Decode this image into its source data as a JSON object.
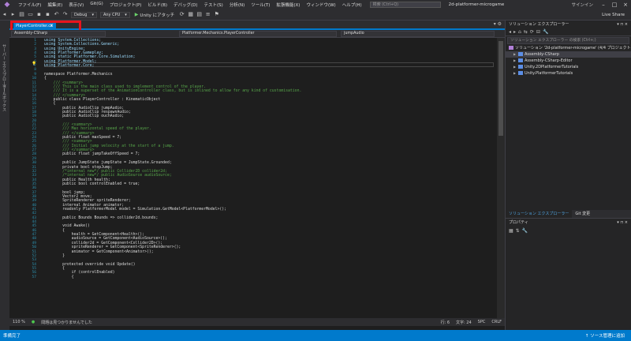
{
  "menu": {
    "items": [
      "ファイル(F)",
      "編集(E)",
      "表示(V)",
      "Git(G)",
      "プロジェクト(P)",
      "ビルド(B)",
      "デバッグ(D)",
      "テスト(S)",
      "分析(N)",
      "ツール(T)",
      "拡張機能(X)",
      "ウィンドウ(W)",
      "ヘルプ(H)"
    ],
    "search_placeholder": "検索 (Ctrl+Q)",
    "solution_name": "2d-platformer-microgame",
    "signin": "サインイン"
  },
  "toolbar": {
    "config": "Debug",
    "platform": "Any CPU",
    "run_label": "Unity にアタッチ",
    "live_share": "Live Share"
  },
  "left_strip": {
    "item1": "サーバー エクスプローラー",
    "item2": "ツールボックス"
  },
  "tabs": {
    "active_file": "PlayerController.cs"
  },
  "navbar": {
    "project": "Assembly-CSharp",
    "class": "Platformer.Mechanics.PlayerController",
    "member": "jumpAudio"
  },
  "editor": {
    "code_lines": [
      {
        "n": "1",
        "t": "using System.Collections;"
      },
      {
        "n": "2",
        "t": "using System.Collections.Generic;"
      },
      {
        "n": "3",
        "t": "using UnityEngine;"
      },
      {
        "n": "4",
        "t": "using Platformer.Gameplay;"
      },
      {
        "n": "5",
        "t": "using static Platformer.Core.Simulation;"
      },
      {
        "n": "6",
        "t": "using Platformer.Model;"
      },
      {
        "n": "7",
        "t": "using Platformer.Core;"
      },
      {
        "n": "8",
        "t": ""
      },
      {
        "n": "9",
        "t": "namespace Platformer.Mechanics"
      },
      {
        "n": "10",
        "t": "{"
      },
      {
        "n": "11",
        "t": "    /// <summary>"
      },
      {
        "n": "12",
        "t": "    /// This is the main class used to implement control of the player."
      },
      {
        "n": "13",
        "t": "    /// It is a superset of the AnimationController class, but is inlined to allow for any kind of customisation."
      },
      {
        "n": "14",
        "t": "    /// </summary>"
      },
      {
        "n": "15",
        "t": "    public class PlayerController : KinematicObject"
      },
      {
        "n": "16",
        "t": "    {"
      },
      {
        "n": "17",
        "t": "        public AudioClip jumpAudio;"
      },
      {
        "n": "18",
        "t": "        public AudioClip respawnAudio;"
      },
      {
        "n": "19",
        "t": "        public AudioClip ouchAudio;"
      },
      {
        "n": "20",
        "t": ""
      },
      {
        "n": "21",
        "t": "        /// <summary>"
      },
      {
        "n": "22",
        "t": "        /// Max horizontal speed of the player."
      },
      {
        "n": "23",
        "t": "        /// </summary>"
      },
      {
        "n": "24",
        "t": "        public float maxSpeed = 7;"
      },
      {
        "n": "25",
        "t": "        /// <summary>"
      },
      {
        "n": "26",
        "t": "        /// Initial jump velocity at the start of a jump."
      },
      {
        "n": "27",
        "t": "        /// </summary>"
      },
      {
        "n": "28",
        "t": "        public float jumpTakeOffSpeed = 7;"
      },
      {
        "n": "29",
        "t": ""
      },
      {
        "n": "30",
        "t": "        public JumpState jumpState = JumpState.Grounded;"
      },
      {
        "n": "31",
        "t": "        private bool stopJump;"
      },
      {
        "n": "32",
        "t": "        /*internal new*/ public Collider2D collider2d;"
      },
      {
        "n": "33",
        "t": "        /*internal new*/ public AudioSource audioSource;"
      },
      {
        "n": "34",
        "t": "        public Health health;"
      },
      {
        "n": "35",
        "t": "        public bool controlEnabled = true;"
      },
      {
        "n": "36",
        "t": ""
      },
      {
        "n": "37",
        "t": "        bool jump;"
      },
      {
        "n": "38",
        "t": "        Vector2 move;"
      },
      {
        "n": "39",
        "t": "        SpriteRenderer spriteRenderer;"
      },
      {
        "n": "40",
        "t": "        internal Animator animator;"
      },
      {
        "n": "41",
        "t": "        readonly PlatformerModel model = Simulation.GetModel<PlatformerModel>();"
      },
      {
        "n": "42",
        "t": ""
      },
      {
        "n": "43",
        "t": "        public Bounds Bounds => collider2d.bounds;"
      },
      {
        "n": "44",
        "t": ""
      },
      {
        "n": "45",
        "t": "        void Awake()"
      },
      {
        "n": "46",
        "t": "        {"
      },
      {
        "n": "47",
        "t": "            health = GetComponent<Health>();"
      },
      {
        "n": "48",
        "t": "            audioSource = GetComponent<AudioSource>();"
      },
      {
        "n": "49",
        "t": "            collider2d = GetComponent<Collider2D>();"
      },
      {
        "n": "50",
        "t": "            spriteRenderer = GetComponent<SpriteRenderer>();"
      },
      {
        "n": "51",
        "t": "            animator = GetComponent<Animator>();"
      },
      {
        "n": "52",
        "t": "        }"
      },
      {
        "n": "53",
        "t": ""
      },
      {
        "n": "54",
        "t": "        protected override void Update()"
      },
      {
        "n": "55",
        "t": "        {"
      },
      {
        "n": "56",
        "t": "            if (controlEnabled)"
      },
      {
        "n": "57",
        "t": "            {"
      }
    ]
  },
  "editor_status": {
    "zoom": "110 %",
    "issues": "問題は見つかりませんでした",
    "line": "行: 6",
    "col": "文字: 24",
    "spc": "SPC",
    "eol": "CRLF"
  },
  "solution_explorer": {
    "title": "ソリューション エクスプローラー",
    "search_placeholder": "ソリューション エクスプローラー の検索 (Ctrl+;)",
    "solution_label": "ソリューション '2d-platformer-microgame' (4/4 プロジェクト)",
    "projects": [
      "Assembly-CSharp",
      "Assembly-CSharp-Editor",
      "Unity.2DPlatformerTutorials",
      "Unity.PlatformerTutorials"
    ]
  },
  "pane_tabs": {
    "tab1": "ソリューション エクスプローラー",
    "tab2": "Git 変更"
  },
  "properties": {
    "title": "プロパティ"
  },
  "statusbar": {
    "left": "準備完了",
    "right": "↑ ソース管理に追加"
  },
  "colors": {
    "accent": "#007acc",
    "highlight": "#e8141e"
  }
}
